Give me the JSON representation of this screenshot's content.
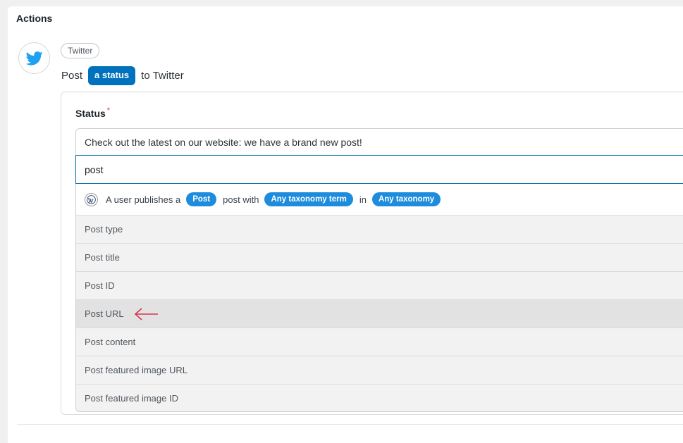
{
  "actions": {
    "title": "Actions"
  },
  "integration": {
    "name": "Twitter",
    "icon": "twitter-bird-icon"
  },
  "action_sentence": {
    "prefix": "Post",
    "token": "a status",
    "suffix": "to Twitter"
  },
  "status_field": {
    "label": "Status",
    "required_mark": "*",
    "value": "Check out the latest on our website: we have a brand new post!"
  },
  "search": {
    "value": "post"
  },
  "trigger": {
    "icon": "wordpress-icon",
    "text_before": "A user publishes a",
    "post_pill": "Post",
    "text_middle": "post with",
    "taxonomy_term_pill": "Any taxonomy term",
    "text_in": "in",
    "taxonomy_pill": "Any taxonomy"
  },
  "options": [
    {
      "label": "Post type"
    },
    {
      "label": "Post title"
    },
    {
      "label": "Post ID"
    },
    {
      "label": "Post URL",
      "highlighted": true
    },
    {
      "label": "Post content"
    },
    {
      "label": "Post featured image URL"
    },
    {
      "label": "Post featured image ID"
    }
  ],
  "colors": {
    "accent": "#0071bc",
    "pill": "#1e8cdd",
    "twitter": "#1da1f2",
    "arrow": "#d63652",
    "required": "#d63638"
  }
}
